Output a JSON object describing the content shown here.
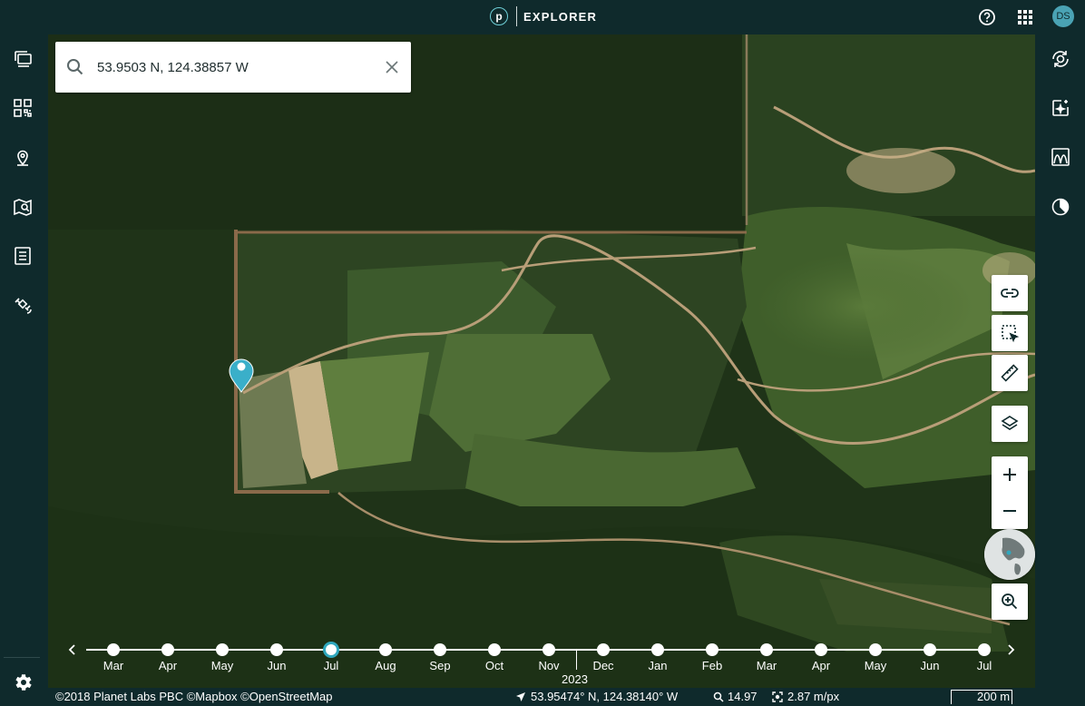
{
  "header": {
    "logo_letter": "p",
    "app_title": "EXPLORER",
    "avatar_initials": "DS"
  },
  "search": {
    "value": "53.9503 N, 124.38857 W"
  },
  "timeline": {
    "months": [
      "Mar",
      "Apr",
      "May",
      "Jun",
      "Jul",
      "Aug",
      "Sep",
      "Oct",
      "Nov",
      "Dec",
      "Jan",
      "Feb",
      "Mar",
      "Apr",
      "May",
      "Jun",
      "Jul"
    ],
    "selected_index": 4,
    "year_label": "2023"
  },
  "status_bar": {
    "attribution": "©2018 Planet Labs PBC ©Mapbox ©OpenStreetMap",
    "coordinates": "53.95474° N, 124.38140° W",
    "zoom": "14.97",
    "resolution": "2.87 m/px",
    "scale": "200 m"
  },
  "colors": {
    "chrome": "#0f2a2c",
    "accent": "#2fa7bd",
    "marker": "#3aafc9"
  }
}
